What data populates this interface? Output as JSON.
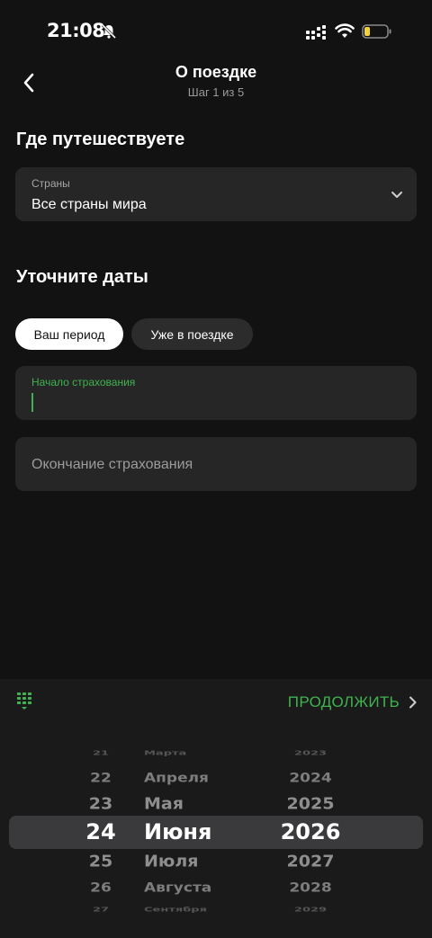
{
  "status_bar": {
    "time": "21:08"
  },
  "header": {
    "title": "О поездке",
    "subtitle": "Шаг 1 из 5"
  },
  "destination": {
    "section_title": "Где путешествуете",
    "country_label": "Страны",
    "country_value": "Все страны мира"
  },
  "dates": {
    "section_title": "Уточните даты",
    "tabs": [
      {
        "label": "Ваш период",
        "active": true
      },
      {
        "label": "Уже в поездке",
        "active": false
      }
    ],
    "start_field_label": "Начало страхования",
    "start_field_value": "",
    "end_field_placeholder": "Окончание страхования"
  },
  "toolbar": {
    "continue_label": "ПРОДОЛЖИТЬ"
  },
  "date_picker": {
    "days": [
      "21",
      "22",
      "23",
      "24",
      "25",
      "26",
      "27"
    ],
    "months": [
      "Марта",
      "Апреля",
      "Мая",
      "Июня",
      "Июля",
      "Августа",
      "Сентября"
    ],
    "years": [
      "2023",
      "2024",
      "2025",
      "2026",
      "2027",
      "2028",
      "2029"
    ],
    "selected": {
      "day": "24",
      "month": "Июня",
      "year": "2026"
    }
  },
  "colors": {
    "accent": "#3fb34f",
    "background": "#121212",
    "field": "#262626",
    "sheet": "#1a1a1a"
  }
}
